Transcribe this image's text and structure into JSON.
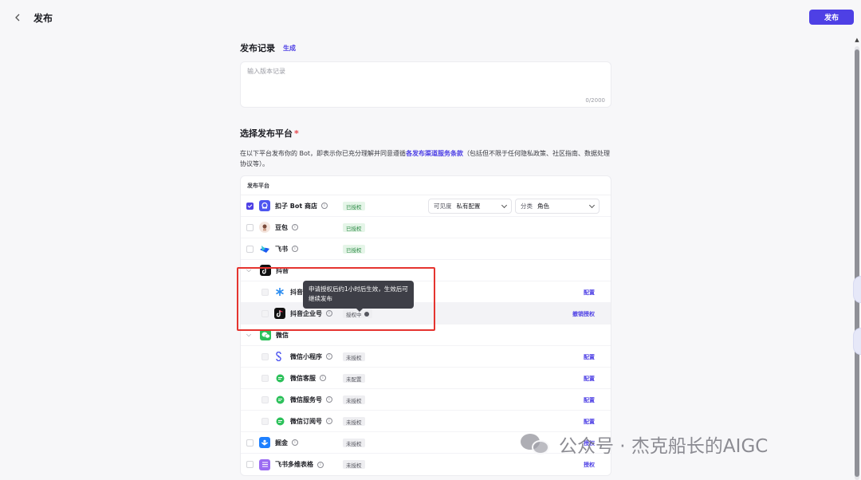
{
  "header": {
    "title": "发布",
    "publish_label": "发布"
  },
  "record": {
    "title": "发布记录",
    "generate_label": "生成",
    "placeholder": "输入版本记录",
    "counter": "0/2000"
  },
  "platforms": {
    "title": "选择发布平台",
    "required_mark": "*",
    "desc_prefix": "在以下平台发布你的 Bot，即表示你已充分理解并同意遵循",
    "desc_link": "各发布渠道服务条款",
    "desc_suffix": "（包括但不限于任何隐私政策、社区指南、数据处理协议等）。",
    "table_header": "发布平台",
    "coze_store": {
      "name": "扣子 Bot 商店",
      "status": "已授权",
      "visibility_label": "可见度",
      "visibility_value": "私有配置",
      "category_label": "分类",
      "category_value": "角色"
    },
    "doubao": {
      "name": "豆包",
      "status": "已授权"
    },
    "feishu": {
      "name": "飞书",
      "status": "已授权"
    },
    "douyin_group": {
      "name": "抖音"
    },
    "douyin_mini": {
      "name": "抖音",
      "action": "配置"
    },
    "douyin_ent": {
      "name": "抖音企业号",
      "status": "授权中",
      "action": "撤销授权"
    },
    "wechat_group": {
      "name": "微信"
    },
    "wx_mini": {
      "name": "微信小程序",
      "status": "未授权",
      "action": "配置"
    },
    "wx_kf": {
      "name": "微信客服",
      "status": "未配置",
      "action": "配置"
    },
    "wx_service": {
      "name": "微信服务号",
      "status": "未授权",
      "action": "配置"
    },
    "wx_sub": {
      "name": "微信订阅号",
      "status": "未授权",
      "action": "配置"
    },
    "juejin": {
      "name": "掘金",
      "status": "未授权",
      "action": "授权"
    },
    "feishu_sheet": {
      "name": "飞书多维表格",
      "status": "未授权",
      "action": "授权"
    }
  },
  "tooltip": {
    "text": "申请授权后约1小时后生效，生效后可继续发布"
  },
  "watermark": {
    "text": "公众号 · 杰克船长的AIGC"
  }
}
